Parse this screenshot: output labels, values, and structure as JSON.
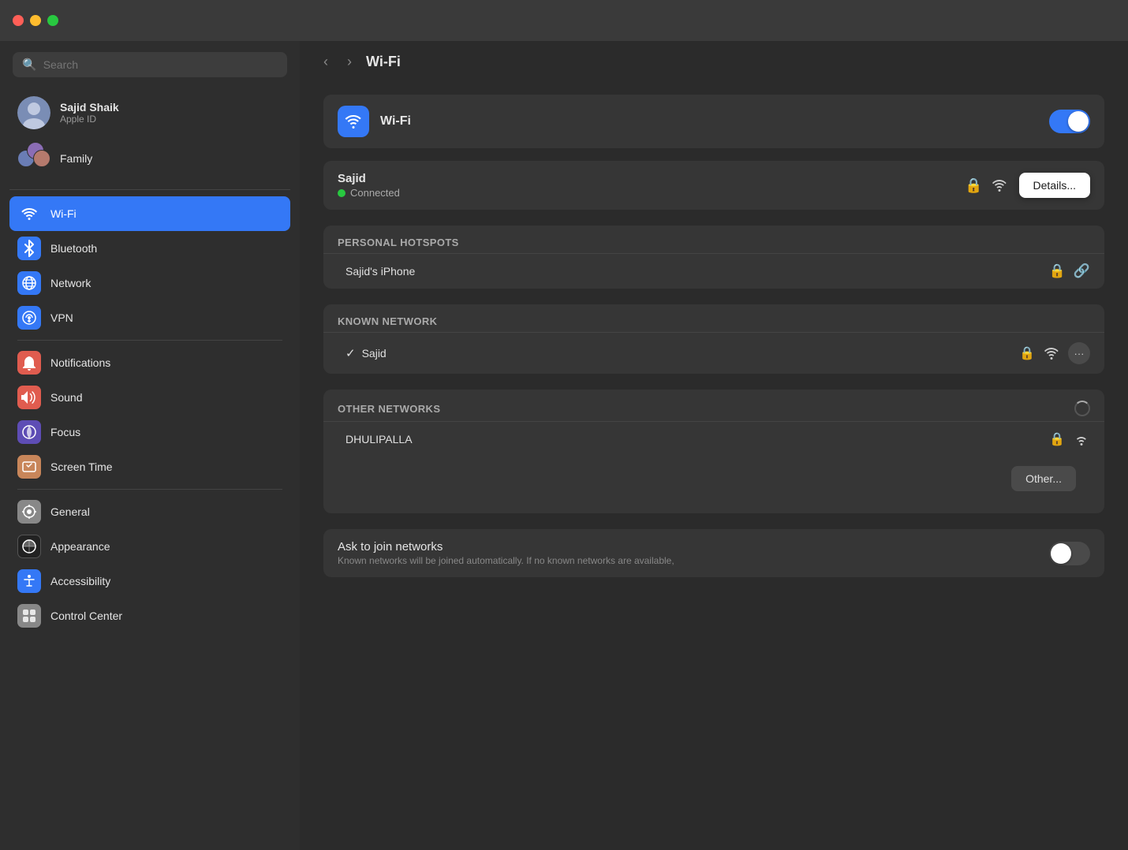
{
  "window": {
    "title": "Wi-Fi"
  },
  "titlebar": {
    "traffic_red": "close",
    "traffic_yellow": "minimize",
    "traffic_green": "maximize"
  },
  "sidebar": {
    "search_placeholder": "Search",
    "profile": {
      "name": "Sajid Shaik",
      "subtitle": "Apple ID"
    },
    "family_label": "Family",
    "nav_items": [
      {
        "id": "wifi",
        "label": "Wi-Fi",
        "icon": "wifi",
        "active": true
      },
      {
        "id": "bluetooth",
        "label": "Bluetooth",
        "icon": "bluetooth",
        "active": false
      },
      {
        "id": "network",
        "label": "Network",
        "icon": "network",
        "active": false
      },
      {
        "id": "vpn",
        "label": "VPN",
        "icon": "vpn",
        "active": false
      },
      {
        "id": "notifications",
        "label": "Notifications",
        "icon": "notifications",
        "active": false
      },
      {
        "id": "sound",
        "label": "Sound",
        "icon": "sound",
        "active": false
      },
      {
        "id": "focus",
        "label": "Focus",
        "icon": "focus",
        "active": false
      },
      {
        "id": "screentime",
        "label": "Screen Time",
        "icon": "screentime",
        "active": false
      },
      {
        "id": "general",
        "label": "General",
        "icon": "general",
        "active": false
      },
      {
        "id": "appearance",
        "label": "Appearance",
        "icon": "appearance",
        "active": false
      },
      {
        "id": "accessibility",
        "label": "Accessibility",
        "icon": "accessibility",
        "active": false
      },
      {
        "id": "controlcenter",
        "label": "Control Center",
        "icon": "controlcenter",
        "active": false
      }
    ]
  },
  "content": {
    "page_title": "Wi-Fi",
    "wifi_toggle": {
      "label": "Wi-Fi",
      "enabled": true
    },
    "connected_network": {
      "name": "Sajid",
      "status": "Connected",
      "details_btn_label": "Details..."
    },
    "personal_hotspots": {
      "section_title": "Personal Hotspots",
      "items": [
        {
          "name": "Sajid's iPhone"
        }
      ]
    },
    "known_networks": {
      "section_title": "Known Network",
      "items": [
        {
          "name": "Sajid",
          "connected": true
        }
      ]
    },
    "other_networks": {
      "section_title": "Other Networks",
      "items": [
        {
          "name": "DHULIPALLA"
        }
      ],
      "other_btn_label": "Other..."
    },
    "ask_to_join": {
      "title": "Ask to join networks",
      "subtitle": "Known networks will be joined automatically. If no known networks are available,",
      "enabled": false
    }
  }
}
